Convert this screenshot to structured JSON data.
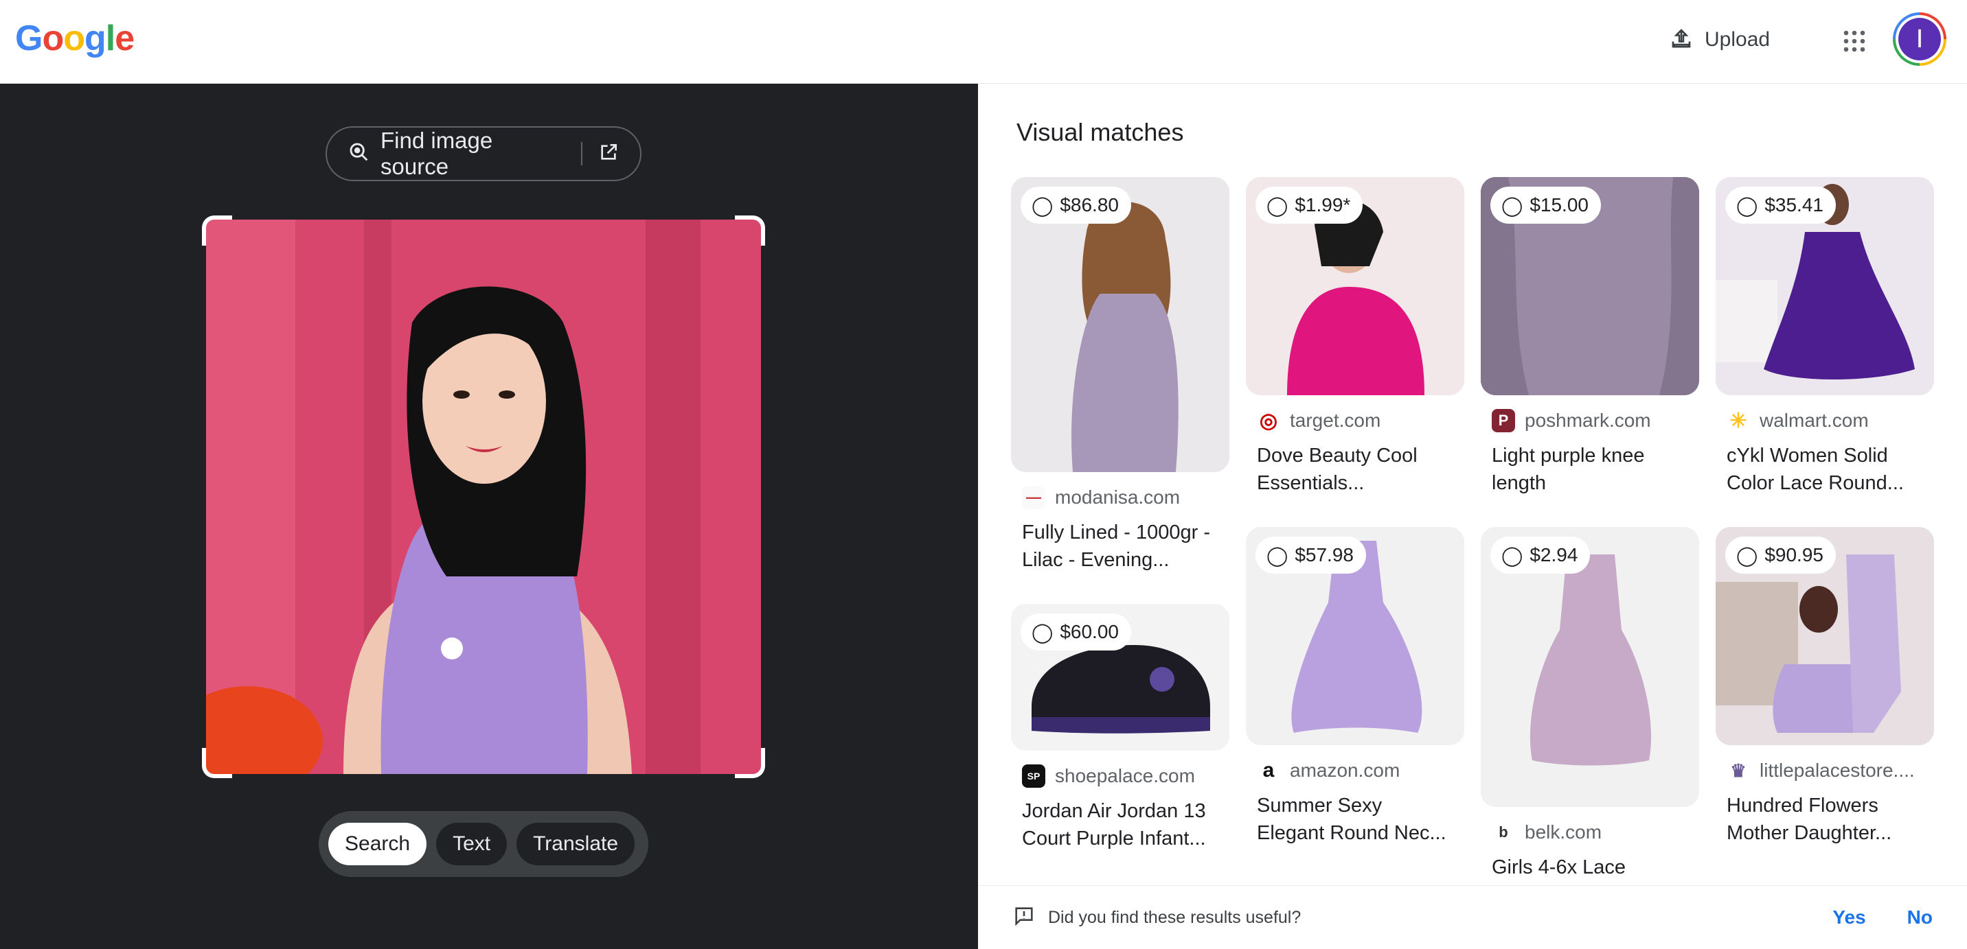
{
  "header": {
    "logo_letters": [
      {
        "ch": "G",
        "color": "#4285f4"
      },
      {
        "ch": "o",
        "color": "#ea4335"
      },
      {
        "ch": "o",
        "color": "#fbbc05"
      },
      {
        "ch": "g",
        "color": "#4285f4"
      },
      {
        "ch": "l",
        "color": "#34a853"
      },
      {
        "ch": "e",
        "color": "#ea4335"
      }
    ],
    "upload_label": "Upload",
    "avatar_initial": "I",
    "avatar_color": "#5b2fb3"
  },
  "left": {
    "find_source_label": "Find image source",
    "modes": [
      {
        "label": "Search",
        "active": true
      },
      {
        "label": "Text",
        "active": false
      },
      {
        "label": "Translate",
        "active": false
      }
    ]
  },
  "right": {
    "section_title": "Visual matches",
    "cards": [
      {
        "price": "$86.80",
        "site": "modanisa.com",
        "title": "Fully Lined - 1000gr - Lilac - Evening...",
        "fav_color": "#f5f5f5",
        "fav_glyph": "—"
      },
      {
        "price": "$60.00",
        "site": "shoepalace.com",
        "title": "Jordan Air Jordan 13 Court Purple Infant...",
        "fav_color": "#111111",
        "fav_glyph": "SP"
      },
      {
        "price": "$1.99*",
        "site": "target.com",
        "title": "Dove Beauty Cool Essentials...",
        "fav_color": "#ffffff",
        "fav_glyph": "◎"
      },
      {
        "price": "$57.98",
        "site": "amazon.com",
        "title": "Summer Sexy Elegant Round Nec...",
        "fav_color": "#ffffff",
        "fav_glyph": "a"
      },
      {
        "price": "$15.00",
        "site": "poshmark.com",
        "title": "Light purple knee length",
        "fav_color": "#822432",
        "fav_glyph": "P"
      },
      {
        "price": "$2.94",
        "site": "belk.com",
        "title": "Girls 4-6x Lace",
        "fav_color": "#ffffff",
        "fav_glyph": "b"
      },
      {
        "price": "$35.41",
        "site": "walmart.com",
        "title": "cYkl Women Solid Color Lace Round...",
        "fav_color": "#ffffff",
        "fav_glyph": "✳"
      },
      {
        "price": "$90.95",
        "site": "littlepalacestore....",
        "title": "Hundred Flowers Mother Daughter...",
        "fav_color": "#ffffff",
        "fav_glyph": "♛"
      }
    ]
  },
  "feedback": {
    "question": "Did you find these results useful?",
    "yes": "Yes",
    "no": "No"
  }
}
